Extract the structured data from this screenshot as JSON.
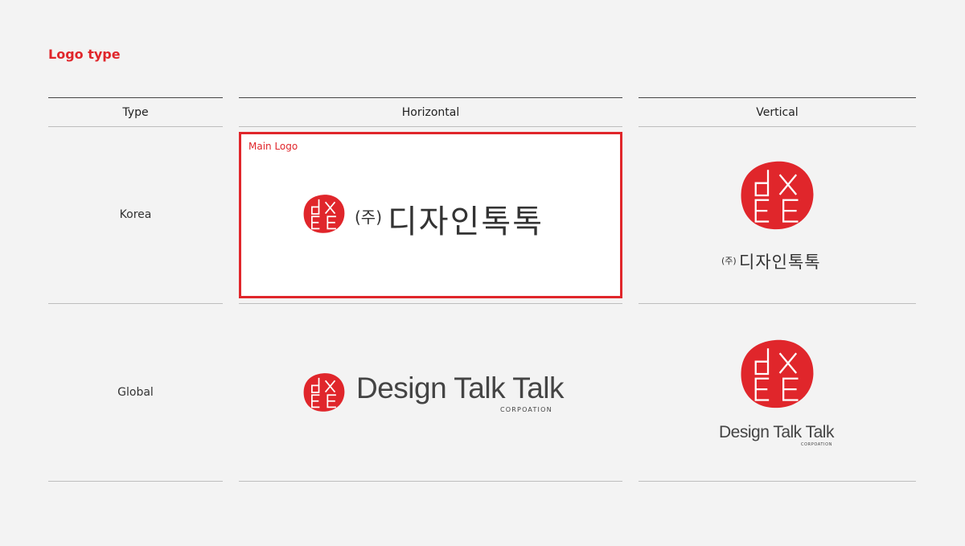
{
  "section": {
    "title": "Logo type"
  },
  "columns": {
    "type": "Type",
    "horizontal": "Horizontal",
    "vertical": "Vertical"
  },
  "rows": {
    "korea": "Korea",
    "global": "Global"
  },
  "main_logo_tag": "Main Logo",
  "logo": {
    "korean_prefix": "(주)",
    "korean_name": "디자인톡톡",
    "english_name": "Design Talk Talk",
    "corp_text": "CORPOATION",
    "emblem_glyphs": "dxEE"
  },
  "colors": {
    "accent": "#e0262b",
    "text": "#222222",
    "line": "#bdbdbd",
    "background": "#f3f3f3"
  },
  "icons": {
    "emblem": "dxee-emblem-icon"
  }
}
